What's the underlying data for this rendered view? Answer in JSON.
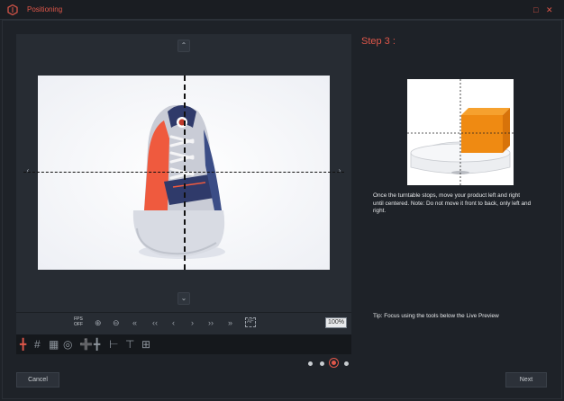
{
  "window": {
    "title": "Positioning",
    "maximize_icon": "maximize-icon",
    "close_icon": "close-icon"
  },
  "preview_toolbar": {
    "fps_line1": "FPS",
    "fps_line2": "OFF",
    "zoom_level": "100%",
    "af_label": "AF"
  },
  "step": {
    "title": "Step 3 :",
    "instructions": "Once the turntable stops, move your product left and right until centered. Note: Do not move it front to back, only left and right.",
    "tip": "Tip: Focus using the tools below the Live Preview"
  },
  "pagination": {
    "total": 4,
    "current": 3
  },
  "buttons": {
    "cancel": "Cancel",
    "next": "Next"
  },
  "colors": {
    "accent": "#e0574a",
    "background": "#1e2228",
    "panel": "#272c33",
    "cube": "#ef8a12"
  }
}
